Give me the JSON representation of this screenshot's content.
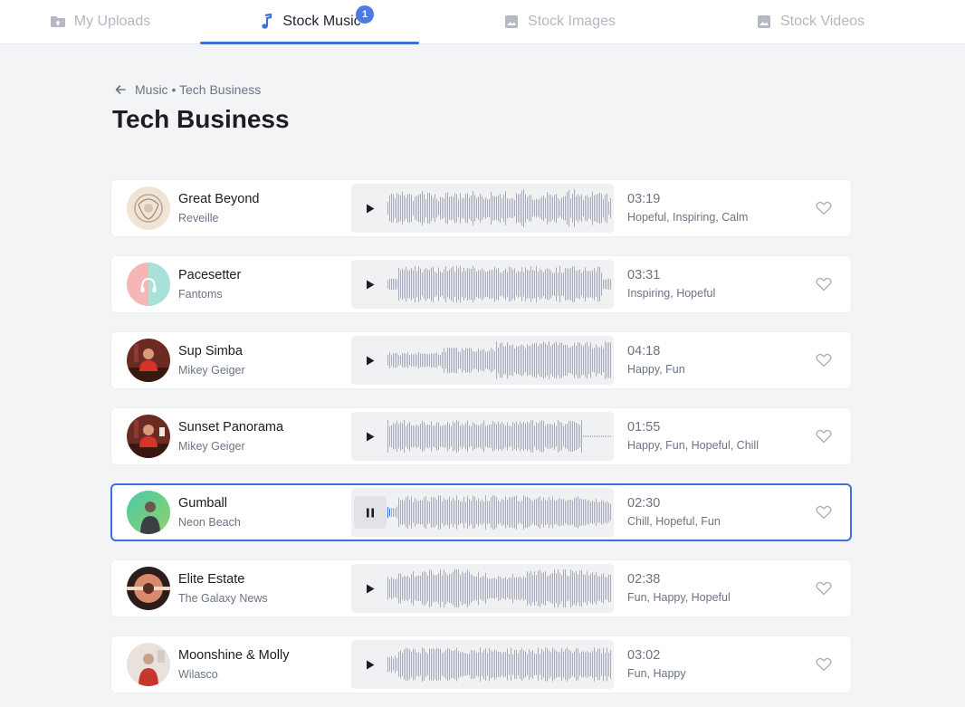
{
  "tabs": [
    {
      "label": "My Uploads",
      "icon": "upload-folder-icon"
    },
    {
      "label": "Stock Music",
      "icon": "music-note-icon",
      "badge": "1"
    },
    {
      "label": "Stock Images",
      "icon": "image-icon"
    },
    {
      "label": "Stock Videos",
      "icon": "image-icon"
    }
  ],
  "breadcrumb": "Music • Tech Business",
  "page_title": "Tech Business",
  "accent_color": "#3d6fe0",
  "tracks": [
    {
      "title": "Great Beyond",
      "artist": "Reveille",
      "duration": "03:19",
      "tags": "Hopeful, Inspiring, Calm",
      "state": "paused"
    },
    {
      "title": "Pacesetter",
      "artist": "Fantoms",
      "duration": "03:31",
      "tags": "Inspiring, Hopeful",
      "state": "paused"
    },
    {
      "title": "Sup Simba",
      "artist": "Mikey Geiger",
      "duration": "04:18",
      "tags": "Happy, Fun",
      "state": "paused"
    },
    {
      "title": "Sunset Panorama",
      "artist": "Mikey Geiger",
      "duration": "01:55",
      "tags": "Happy, Fun, Hopeful, Chill",
      "state": "paused"
    },
    {
      "title": "Gumball",
      "artist": "Neon Beach",
      "duration": "02:30",
      "tags": "Chill, Hopeful, Fun",
      "state": "playing"
    },
    {
      "title": "Elite Estate",
      "artist": "The Galaxy News",
      "duration": "02:38",
      "tags": "Fun, Happy, Hopeful",
      "state": "paused"
    },
    {
      "title": "Moonshine & Molly",
      "artist": "Wilasco",
      "duration": "03:02",
      "tags": "Fun, Happy",
      "state": "paused"
    }
  ]
}
